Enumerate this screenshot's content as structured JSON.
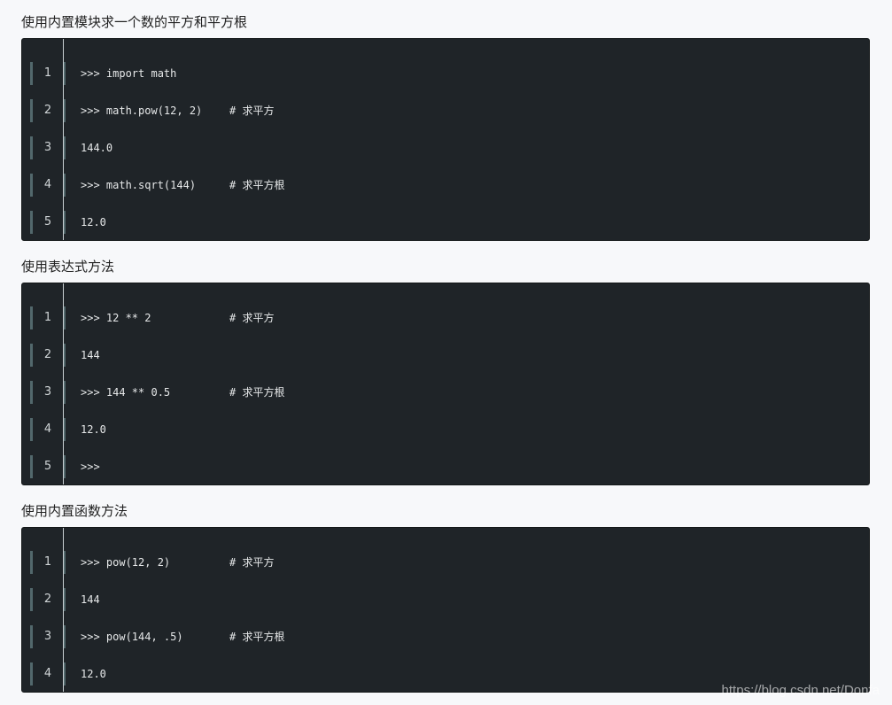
{
  "sections": [
    {
      "title": "使用内置模块求一个数的平方和平方根",
      "lines": [
        {
          "num": "1",
          "code": ">>> import math",
          "comment": ""
        },
        {
          "num": "2",
          "code": ">>> math.pow(12, 2)",
          "comment": "# 求平方"
        },
        {
          "num": "3",
          "code": "144.0",
          "comment": ""
        },
        {
          "num": "4",
          "code": ">>> math.sqrt(144)",
          "comment": "# 求平方根"
        },
        {
          "num": "5",
          "code": "12.0",
          "comment": ""
        }
      ]
    },
    {
      "title": "使用表达式方法",
      "lines": [
        {
          "num": "1",
          "code": ">>> 12 ** 2",
          "comment": "# 求平方"
        },
        {
          "num": "2",
          "code": "144",
          "comment": ""
        },
        {
          "num": "3",
          "code": ">>> 144 ** 0.5",
          "comment": "# 求平方根"
        },
        {
          "num": "4",
          "code": "12.0",
          "comment": ""
        },
        {
          "num": "5",
          "code": ">>>",
          "comment": ""
        }
      ]
    },
    {
      "title": "使用内置函数方法",
      "lines": [
        {
          "num": "1",
          "code": ">>> pow(12, 2)",
          "comment": "# 求平方"
        },
        {
          "num": "2",
          "code": "144",
          "comment": ""
        },
        {
          "num": "3",
          "code": ">>> pow(144, .5)",
          "comment": "# 求平方根"
        },
        {
          "num": "4",
          "code": "12.0",
          "comment": ""
        }
      ]
    }
  ],
  "watermark": "https://blog.csdn.net/Donfa",
  "colors": {
    "page_background": "#f7f8fa",
    "code_background": "#1f2428",
    "gutter_bar": "#52686c",
    "code_text": "#e6e8e9"
  }
}
